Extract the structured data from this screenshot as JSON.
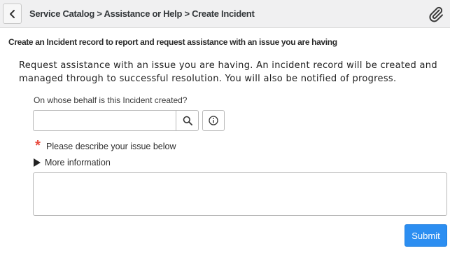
{
  "header": {
    "breadcrumb": {
      "item1": "Service Catalog",
      "sep1": " > ",
      "item2": "Assistance or Help",
      "sep2": " > ",
      "item3": "Create Incident"
    },
    "back_icon": "chevron-left-icon",
    "attach_icon": "paperclip-icon"
  },
  "form": {
    "subtitle": "Create an Incident record to report and request assistance with an issue you are having",
    "description": "Request assistance with an issue you are having. An incident record will be created and managed through to successful resolution. You will also be notified of progress.",
    "behalf_label": "On whose behalf is this Incident created?",
    "behalf_value": "",
    "behalf_placeholder": "",
    "search_icon": "search-icon",
    "info_icon": "info-icon",
    "required_marker": "*",
    "issue_label": "Please describe your issue below",
    "more_info_label": "More information",
    "issue_value": "",
    "submit_label": "Submit"
  },
  "colors": {
    "header_bg": "#f0f0f1",
    "submit_bg": "#2c8ef1",
    "required": "#e8493d"
  }
}
